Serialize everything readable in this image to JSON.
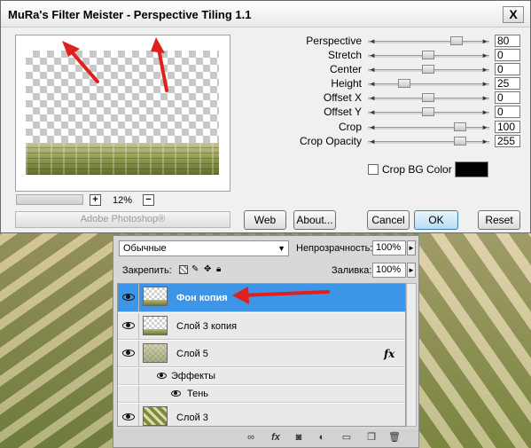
{
  "dialog": {
    "title": "MuRa's Filter Meister - Perspective Tiling 1.1",
    "close_label": "X",
    "zoom": {
      "minus_label": "+",
      "value": "12%",
      "plus_label": "−"
    },
    "brand": "Adobe Photoshop®",
    "params": [
      {
        "label": "Perspective",
        "value": "80",
        "fill": 0.8
      },
      {
        "label": "Stretch",
        "value": "0",
        "fill": 0.5
      },
      {
        "label": "Center",
        "value": "0",
        "fill": 0.5
      },
      {
        "label": "Height",
        "value": "25",
        "fill": 0.25
      },
      {
        "label": "Offset X",
        "value": "0",
        "fill": 0.5
      },
      {
        "label": "Offset Y",
        "value": "0",
        "fill": 0.5
      },
      {
        "label": "Crop",
        "value": "100",
        "fill": 0.84
      },
      {
        "label": "Crop Opacity",
        "value": "255",
        "fill": 0.84
      }
    ],
    "crop_bg_label": "Crop BG Color",
    "crop_bg_color": "#000000",
    "buttons": {
      "web": "Web",
      "about": "About...",
      "cancel": "Cancel",
      "ok": "OK",
      "reset": "Reset"
    }
  },
  "layers_panel": {
    "blend_mode": "Обычные",
    "opacity_label": "Непрозрачность:",
    "opacity_value": "100%",
    "lock_label": "Закрепить:",
    "fill_label": "Заливка:",
    "fill_value": "100%",
    "layers": [
      {
        "name": "Фон копия",
        "selected": true
      },
      {
        "name": "Слой 3 копия",
        "selected": false
      },
      {
        "name": "Слой 5",
        "selected": false,
        "fx": "fx"
      },
      {
        "name": "Слой 3",
        "selected": false
      }
    ],
    "effects_label": "Эффекты",
    "shadow_label": "Тень",
    "bottom_icons": [
      "link-icon",
      "fx-icon",
      "mask-icon",
      "adjustment-icon",
      "folder-icon",
      "new-layer-icon",
      "trash-icon"
    ]
  },
  "colors": {
    "annotation_arrow": "#e0201a",
    "selected_layer": "#3d95e8"
  }
}
